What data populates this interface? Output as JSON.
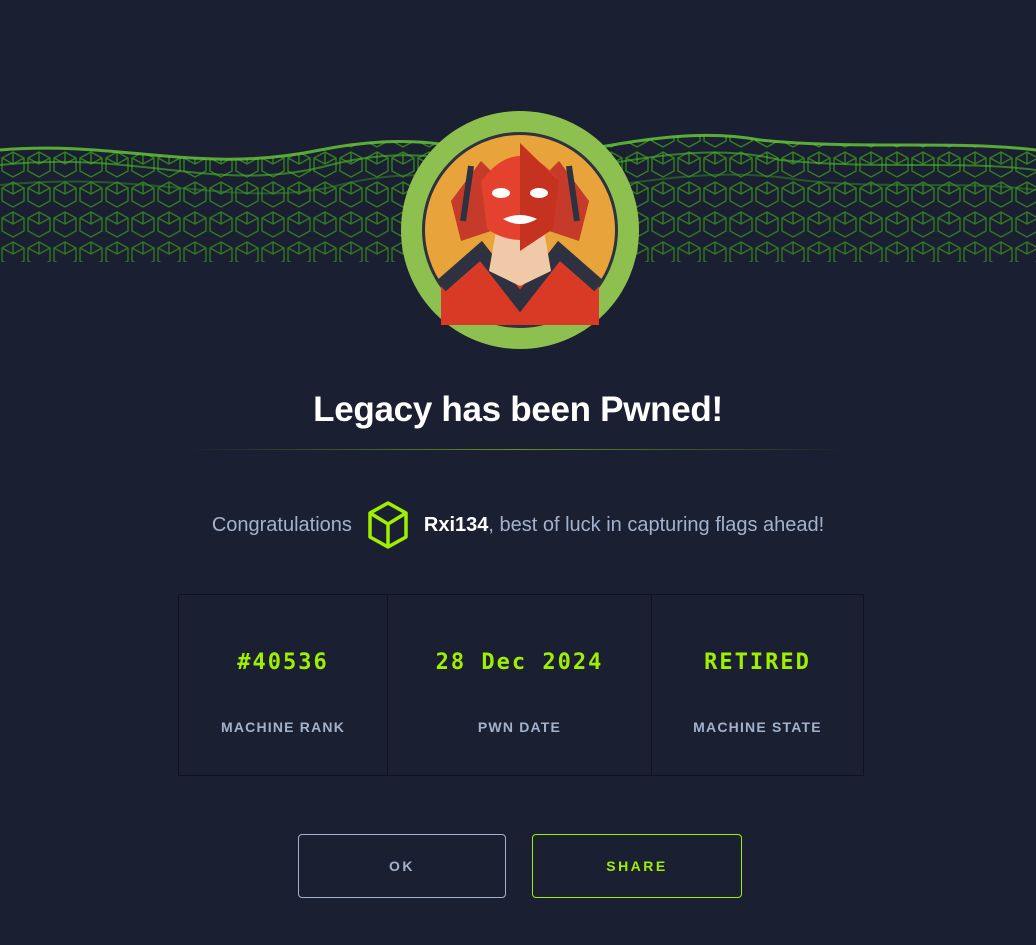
{
  "banner": {
    "image": "green-wave-cube-pattern"
  },
  "avatar": {
    "image": "legacy-machine-avatar-red-masked-figure"
  },
  "title": "Legacy has been Pwned!",
  "congrats": {
    "prefix": "Congratulations",
    "user_icon": "cube-icon",
    "username": "Rxi134",
    "suffix": ", best of luck in capturing flags ahead!"
  },
  "stats": [
    {
      "value": "#40536",
      "label": "MACHINE RANK"
    },
    {
      "value": "28 Dec 2024",
      "label": "PWN DATE"
    },
    {
      "value": "RETIRED",
      "label": "MACHINE STATE"
    }
  ],
  "buttons": {
    "ok": "OK",
    "share": "SHARE"
  },
  "colors": {
    "background": "#1a2031",
    "accent": "#9fef00",
    "muted": "#a4b1cd",
    "ring": "#8dc04f"
  }
}
